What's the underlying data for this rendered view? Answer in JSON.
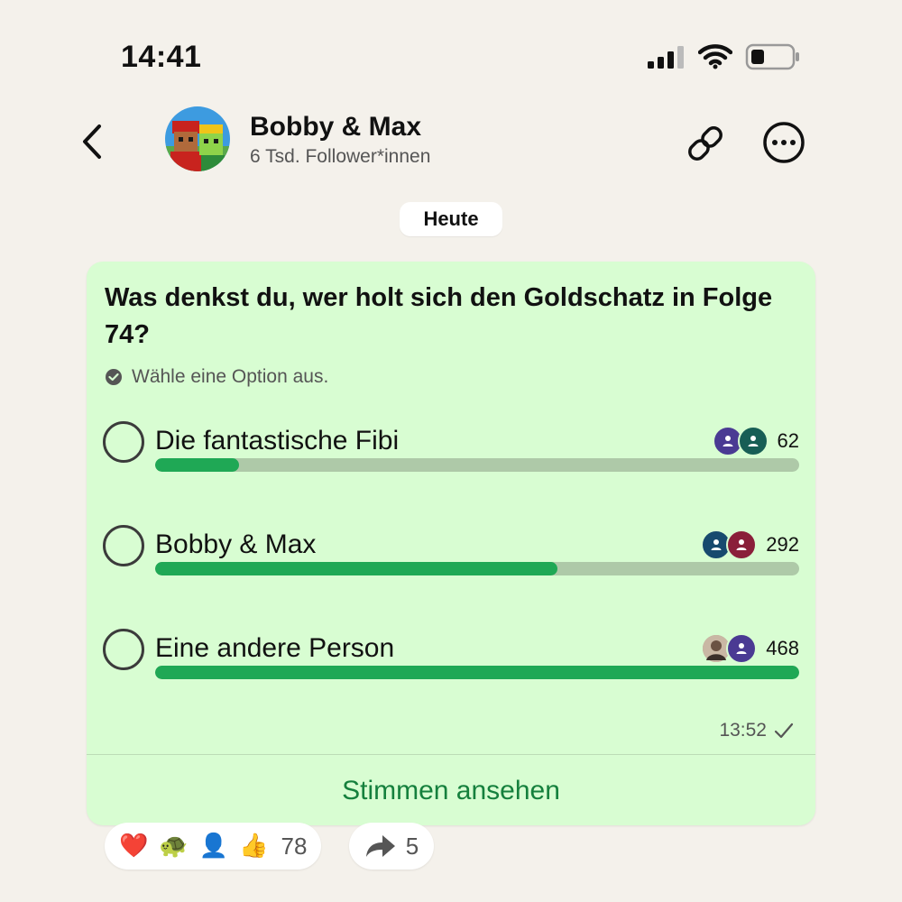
{
  "status_bar": {
    "time": "14:41"
  },
  "header": {
    "name": "Bobby & Max",
    "followers": "6 Tsd. Follower*innen"
  },
  "date_label": "Heute",
  "poll": {
    "question": "Was denkst du, wer holt sich den Goldschatz in Folge 74?",
    "hint": "Wähle eine Option aus.",
    "options": [
      {
        "label": "Die fantastische Fibi",
        "votes": "62",
        "share": 0.13,
        "voter_colors": [
          "#4a3a93",
          "#175e55"
        ]
      },
      {
        "label": "Bobby & Max",
        "votes": "292",
        "share": 0.625,
        "voter_colors": [
          "#174a6e",
          "#8a1f3a"
        ]
      },
      {
        "label": "Eine andere Person",
        "votes": "468",
        "share": 1.0,
        "voter_colors": [
          "#b39b86",
          "#4a3a93"
        ]
      }
    ],
    "time": "13:52",
    "view_votes": "Stimmen ansehen"
  },
  "reactions": {
    "emojis": [
      "❤️",
      "🐢",
      "👤",
      "👍"
    ],
    "count": "78",
    "forwards": "5"
  },
  "colors": {
    "bubble": "#d8fdd2",
    "accent": "#1fa855",
    "link": "#15803d"
  }
}
